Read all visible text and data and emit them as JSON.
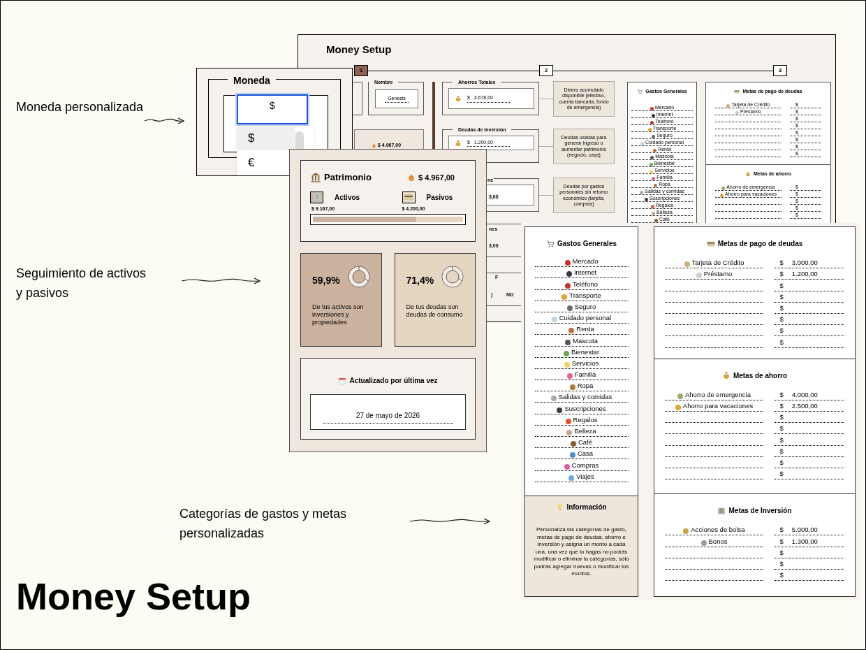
{
  "annotations": [
    {
      "text": "Moneda personalizada"
    },
    {
      "text": "Seguimiento de activos y pasivos"
    },
    {
      "text": "Categorías de gastos y metas personalizadas"
    }
  ],
  "headline": "Money Setup",
  "back_sheet": {
    "title": "Money Setup",
    "steps": [
      {
        "label": "1",
        "selected": true
      },
      {
        "label": "2",
        "selected": false
      },
      {
        "label": "3",
        "selected": false
      }
    ],
    "nombre": {
      "label": "Nombre",
      "value": "Genesis"
    },
    "patrimonio_value": "$ 4.967,00",
    "fields": [
      {
        "label": "Ahorros Totales",
        "currency": "$",
        "value": "3.678,00",
        "note": "Dinero acumulado disponible (efectivo, cuenta bancaria, fondo de emergencia)"
      },
      {
        "label": "Deudas de inversión",
        "currency": "$",
        "value": "1.200,00",
        "note": "Deudas usadas para generar ingreso o aumentar patrimonio (negocio, casa)"
      },
      {
        "note": "Deudas por gastos personales sin retorno económico (tarjeta, compras)"
      }
    ],
    "partial_texts": [
      "ne",
      "3,00",
      "nes",
      "3,00",
      "F",
      ")",
      "NO"
    ],
    "gastos": {
      "title": "Gastos Generales",
      "items": [
        {
          "label": "Mercado",
          "color": "#d62b2b"
        },
        {
          "label": "Internet",
          "color": "#333a44"
        },
        {
          "label": "Teléfono",
          "color": "#c83232"
        },
        {
          "label": "Transporte",
          "color": "#e0a52a"
        },
        {
          "label": "Seguro",
          "color": "#6b6b6b"
        },
        {
          "label": "Cuidado personal",
          "color": "#bcd6e6"
        },
        {
          "label": "Renta",
          "color": "#c4703c"
        },
        {
          "label": "Mascota",
          "color": "#555555"
        },
        {
          "label": "Bienestar",
          "color": "#6aa84f"
        },
        {
          "label": "Servicios",
          "color": "#f4d35e"
        },
        {
          "label": "Familia",
          "color": "#e06680"
        },
        {
          "label": "Ropa",
          "color": "#b07a3c"
        },
        {
          "label": "Salidas y comidas",
          "color": "#aaaaaa"
        },
        {
          "label": "Suscripciones",
          "color": "#3d3d3d"
        },
        {
          "label": "Regalos",
          "color": "#e2552a"
        },
        {
          "label": "Belleza",
          "color": "#c7a48a"
        },
        {
          "label": "Café",
          "color": "#8b5a2b"
        }
      ]
    },
    "metas": [
      {
        "title": "Metas de pago de deudas",
        "rows": [
          {
            "label": "Tarjeta de Crédito",
            "color": "#c9b27a",
            "currency": "$"
          },
          {
            "label": "Préstamo",
            "color": "#cccccc",
            "currency": "$"
          },
          {
            "currency": "$"
          },
          {
            "currency": "$"
          },
          {
            "currency": "$"
          },
          {
            "currency": "$"
          },
          {
            "currency": "$"
          },
          {
            "currency": "$"
          }
        ]
      },
      {
        "title": "Metas de ahorro",
        "rows": [
          {
            "label": "Ahorro de emergencia",
            "color": "#9aa86a",
            "currency": "$"
          },
          {
            "label": "Ahorro para vacaciones",
            "color": "#e8a23a",
            "currency": "$"
          },
          {
            "currency": "$"
          },
          {
            "currency": "$"
          },
          {
            "currency": "$"
          }
        ]
      }
    ]
  },
  "moneda": {
    "title": "Moneda",
    "value": "$",
    "options": [
      {
        "label": "$",
        "selected": true
      },
      {
        "label": "€",
        "selected": false
      }
    ]
  },
  "patrimonio": {
    "title": "Patrimonio",
    "value": "$ 4.967,00",
    "activos": {
      "label": "Activos",
      "value": "$ 9.167,00"
    },
    "pasivos": {
      "label": "Pasivos",
      "value": "$ 4.200,00"
    },
    "level": 0.69,
    "stats": [
      {
        "value": "59,9%",
        "text": "De tus activos son inversiones y propiedades",
        "color": "#cbb3a0"
      },
      {
        "value": "71,4%",
        "text": "De tus deudas son deudas de consumo",
        "color": "#e5d6c2"
      }
    ],
    "updated": {
      "title": "Actualizado por última vez",
      "value": "27 de mayo de 2026"
    }
  },
  "front": {
    "gastos": {
      "title": "Gastos Generales",
      "items": [
        {
          "label": "Mercado",
          "color": "#d62b2b"
        },
        {
          "label": "Internet",
          "color": "#333a44"
        },
        {
          "label": "Teléfono",
          "color": "#c83232"
        },
        {
          "label": "Transporte",
          "color": "#e0a52a"
        },
        {
          "label": "Seguro",
          "color": "#6b6b6b"
        },
        {
          "label": "Cuidado personal",
          "color": "#bcd6e6"
        },
        {
          "label": "Renta",
          "color": "#c4703c"
        },
        {
          "label": "Mascota",
          "color": "#555555"
        },
        {
          "label": "Bienestar",
          "color": "#6aa84f"
        },
        {
          "label": "Servicios",
          "color": "#f4d35e"
        },
        {
          "label": "Familia",
          "color": "#e06680"
        },
        {
          "label": "Ropa",
          "color": "#b07a3c"
        },
        {
          "label": "Salidas y comidas",
          "color": "#aaaaaa"
        },
        {
          "label": "Suscripciones",
          "color": "#3d3d3d"
        },
        {
          "label": "Regalos",
          "color": "#e2552a"
        },
        {
          "label": "Belleza",
          "color": "#c7a48a"
        },
        {
          "label": "Café",
          "color": "#8b5a2b"
        },
        {
          "label": "Casa",
          "color": "#4a90d9"
        },
        {
          "label": "Compras",
          "color": "#e05aa0"
        },
        {
          "label": "Viajes",
          "color": "#6ea8d8"
        }
      ]
    },
    "info": {
      "title": "Información",
      "text": "Personaliza las categorías de gasto, metas de pago de deudas, ahorro e inversión y asigna un monto a cada una, una vez que lo hagas no podrás modificar o eliminar la categorías, sólo podrás agregar nuevas o modificar los montos."
    },
    "metas": [
      {
        "title": "Metas de pago de deudas",
        "rows": [
          {
            "label": "Tarjeta de Crédito",
            "color": "#c9b27a",
            "currency": "$",
            "value": "3.000,00"
          },
          {
            "label": "Préstamo",
            "color": "#cccccc",
            "currency": "$",
            "value": "1.200,00"
          },
          {
            "currency": "$"
          },
          {
            "currency": "$"
          },
          {
            "currency": "$"
          },
          {
            "currency": "$"
          },
          {
            "currency": "$"
          },
          {
            "currency": "$"
          }
        ]
      },
      {
        "title": "Metas de ahorro",
        "rows": [
          {
            "label": "Ahorro de emergencia",
            "color": "#9aa86a",
            "currency": "$",
            "value": "4.000,00"
          },
          {
            "label": "Ahorro para vacaciones",
            "color": "#e8a23a",
            "currency": "$",
            "value": "2.500,00"
          },
          {
            "currency": "$"
          },
          {
            "currency": "$"
          },
          {
            "currency": "$"
          },
          {
            "currency": "$"
          },
          {
            "currency": "$"
          },
          {
            "currency": "$"
          }
        ]
      },
      {
        "title": "Metas de Inversión",
        "rows": [
          {
            "label": "Acciones de bolsa",
            "color": "#c9a040",
            "currency": "$",
            "value": "5.000,00"
          },
          {
            "label": "Bonos",
            "color": "#8aa0a8",
            "currency": "$",
            "value": "1.300,00"
          },
          {
            "currency": "$"
          },
          {
            "currency": "$"
          },
          {
            "currency": "$"
          }
        ]
      }
    ]
  }
}
